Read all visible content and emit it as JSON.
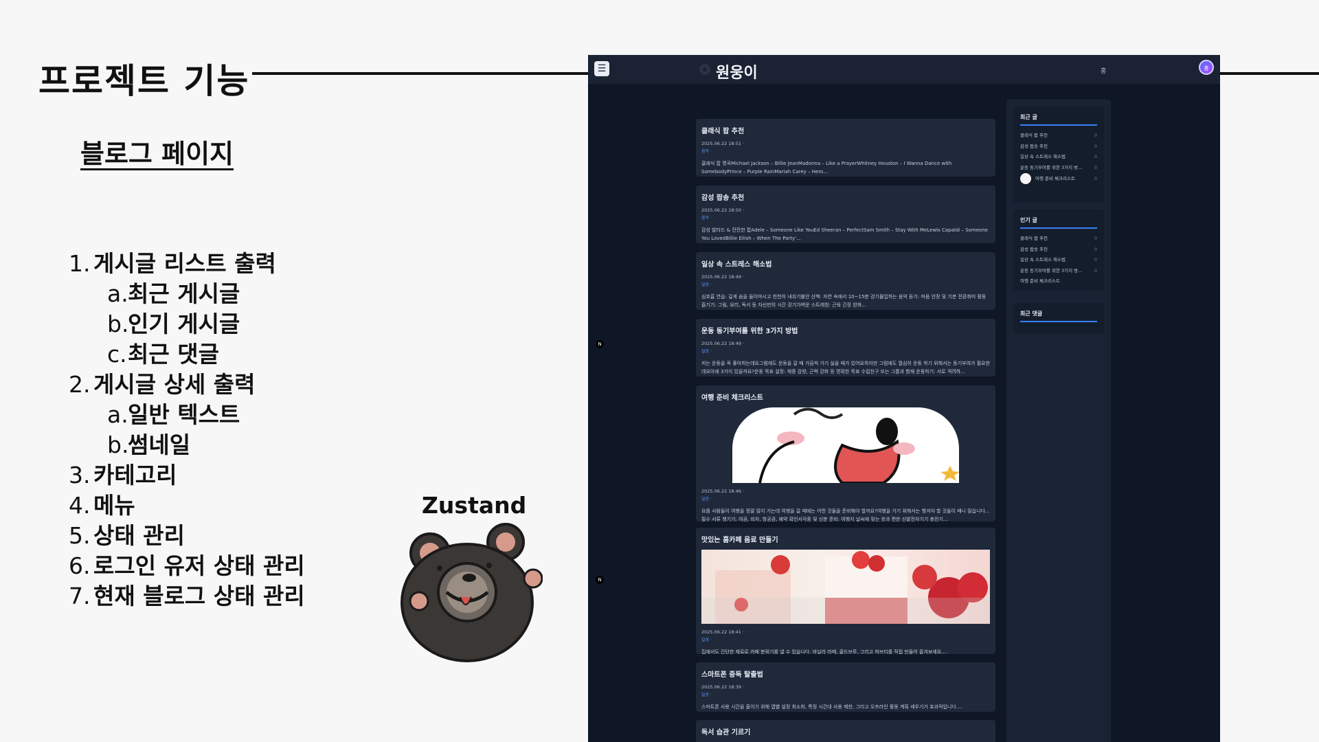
{
  "slide": {
    "title": "프로젝트 기능",
    "subtitle": "블로그 페이지",
    "features": [
      {
        "num": "1.",
        "label": "게시글 리스트 출력",
        "level": 1
      },
      {
        "num": "a.",
        "label": "최근 게시글",
        "level": 2
      },
      {
        "num": "b.",
        "label": "인기 게시글",
        "level": 2
      },
      {
        "num": "c.",
        "label": "최근 댓글",
        "level": 2
      },
      {
        "num": "2.",
        "label": "게시글 상세 출력",
        "level": 1
      },
      {
        "num": "a.",
        "label": "일반 텍스트",
        "level": 2
      },
      {
        "num": "b.",
        "label": "썸네일",
        "level": 2
      },
      {
        "num": "3.",
        "label": "카테고리",
        "level": 1
      },
      {
        "num": "4.",
        "label": "메뉴",
        "level": 1
      },
      {
        "num": "5.",
        "label": "상태 관리",
        "level": 1
      },
      {
        "num": "6.",
        "label": "로그인 유저 상태 관리",
        "level": 1
      },
      {
        "num": "7.",
        "label": "현재 블로그 상태 관리",
        "level": 1
      }
    ],
    "library_label": "Zustand"
  },
  "app": {
    "brand": "원웅이",
    "menu_icon": "hamburger-icon",
    "lang_badge": "홍",
    "avatar_initial": "홍",
    "side_marker": "N",
    "posts": [
      {
        "title": "클래식 팝 추천",
        "date": "2025.06.22 18:51 ·",
        "category": "음악 ·",
        "excerpt": "클래식 팝 명곡Michael Jackson – Billie JeanMadonna – Like a PrayerWhitney Houston – I Wanna Dance with SomebodyPrince – Purple RainMariah Carey – Hero..."
      },
      {
        "title": "감성 팝송 추천",
        "date": "2025.06.22 18:50 ·",
        "category": "음악 ·",
        "excerpt": "감성 발라드 & 잔잔한 팝Adele – Someone Like YouEd Sheeran – PerfectSam Smith – Stay With MeLewis Capaldi – Someone You LovedBillie Eilish – When The Party'..."
      },
      {
        "title": "일상 속 스트레스 해소법",
        "date": "2025.06.22 18:49 ·",
        "category": "일상 ·",
        "excerpt": "심호흡 연습: 깊게 숨을 들이마시고 천천히 내쉬기불안 산책: 자연 속에서 10~15분 걷기몰입하는 음악 듣기: 마음 안정 및 기분 전환취미 활동 즐기기: 그림, 요리, 독서 등 자신만의 시간 갖기가벼운 스트레칭: 근육 긴장 완화..."
      },
      {
        "title": "운동 동기부여를 위한 3가지 방법",
        "date": "2025.06.22 18:49 ·",
        "category": "일상 ·",
        "excerpt": "저는 운동을 꼭 좋아하는데요그럼에도 운동을 갈 때 가끔씩 가기 싫을 때가 있어요하지만 그럼에도 열심히 운동 하기 위해서는 동기부여가 필요한데요아래 3가지 있을까요?운동 목표 설정: 체중 감량, 근력 강화 등 명확한 목표 수립친구 또는 그룹과 함께 운동하기: 서로 격려하..."
      },
      {
        "title": "여행 준비 체크리스트",
        "date": "2025.06.22 18:46 ·",
        "category": "일상 ·",
        "excerpt": "요즘 사람들이 여행을 정말 많이 가는데 여행을 갈 때에는 어떤 것들을 준비해야 할까요?여행을 가기 위해서는 챙겨야 할 것들이 매니 많습니다...필수 서류 챙기기: 여권, 비자, 항공권, 예약 확인서각종 및 신분 준비: 여행지 날씨에 맞는 옷과 편한 신발전자기기 충전기..."
      },
      {
        "title": "맛있는 홈카페 음료 만들기",
        "date": "2025.06.22 18:41 ·",
        "category": "일상 ·",
        "excerpt": "집에서도 간단한 재료로 카페 분위기를 낼 수 있습니다. 바닐라 라떼, 콜드브루, 그리고 허브티를 직접 만들어 즐겨보세요...."
      },
      {
        "title": "스마트폰 중독 탈출법",
        "date": "2025.06.22 18:39 ·",
        "category": "일상 ·",
        "excerpt": "스마트폰 사용 시간을 줄이기 위해 앱별 설정 최소화, 특정 시간대 사용 제한, 그리고 오프라인 활동 계획 세우기가 효과적입니다...."
      },
      {
        "title": "독서 습관 기르기",
        "date": "",
        "category": "",
        "excerpt": ""
      }
    ],
    "sidebar": {
      "recent_posts": {
        "title": "최근 글",
        "items": [
          {
            "label": "클래식 팝 추천",
            "count": "0"
          },
          {
            "label": "감성 팝송 추천",
            "count": "0"
          },
          {
            "label": "일상 속 스트레스 해소법",
            "count": "0"
          },
          {
            "label": "운동 동기부여를 위한 3가지 방...",
            "count": "0"
          },
          {
            "label": "여행 준비 체크리스트",
            "count": "0"
          }
        ]
      },
      "popular_posts": {
        "title": "인기 글",
        "items": [
          {
            "label": "클래식 팝 추천",
            "count": "0"
          },
          {
            "label": "감성 팝송 추천",
            "count": "0"
          },
          {
            "label": "일상 속 스트레스 해소법",
            "count": "0"
          },
          {
            "label": "운동 동기부여를 위한 3가지 방...",
            "count": "0"
          },
          {
            "label": "여행 준비 체크리스트",
            "count": ""
          }
        ]
      },
      "recent_comments": {
        "title": "최근 댓글"
      }
    }
  }
}
